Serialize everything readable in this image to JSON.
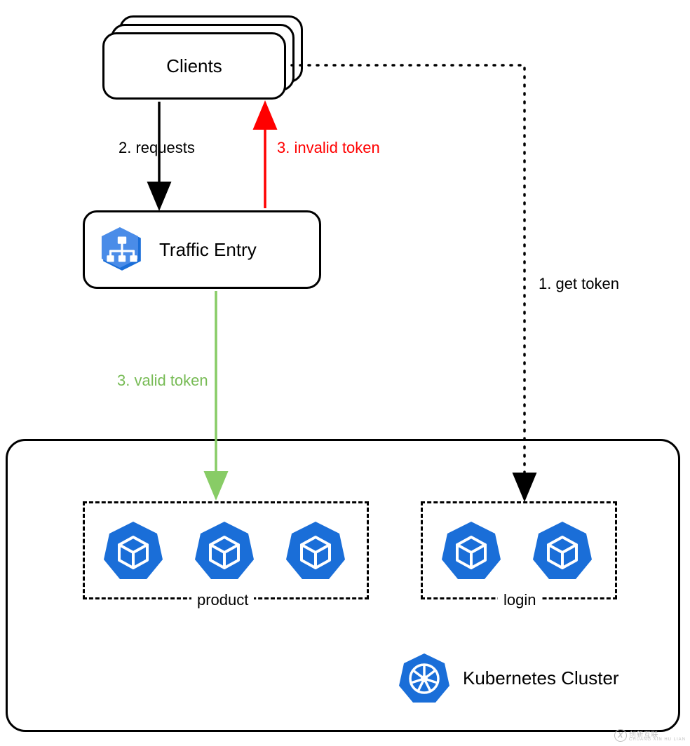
{
  "nodes": {
    "clients": {
      "label": "Clients"
    },
    "traffic_entry": {
      "label": "Traffic Entry"
    }
  },
  "edges": {
    "get_token": {
      "label": "1. get token",
      "color": "#000000"
    },
    "requests": {
      "label": "2. requests",
      "color": "#000000"
    },
    "invalid_token": {
      "label": "3. invalid token",
      "color": "#ff0000"
    },
    "valid_token": {
      "label": "3. valid token",
      "color": "#77cc55"
    }
  },
  "groups": {
    "product": {
      "label": "product",
      "pod_count": 3
    },
    "login": {
      "label": "login",
      "pod_count": 2
    }
  },
  "cluster": {
    "label": "Kubernetes Cluster"
  },
  "colors": {
    "brand_blue": "#1a6ed8",
    "valid_green": "#88cc66",
    "invalid_red": "#ff0000"
  },
  "watermark": {
    "brand": "创新互联",
    "sub": "CHUANG XIN HU LIAN"
  }
}
